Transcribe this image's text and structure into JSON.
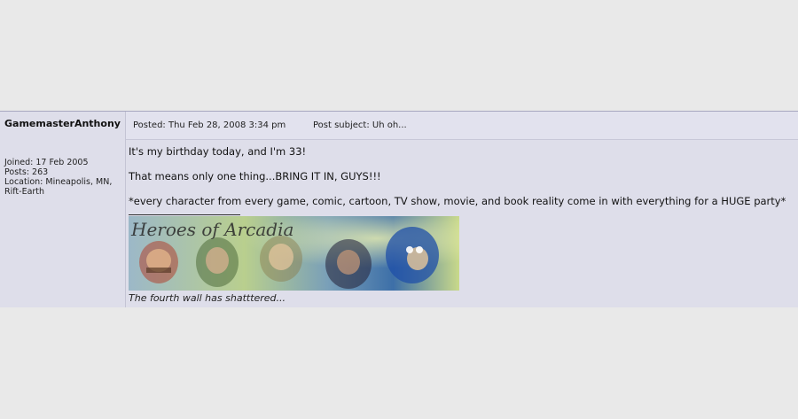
{
  "author": {
    "name": "GamemasterAnthony",
    "joined": "Joined: 17 Feb 2005",
    "posts": "Posts: 263",
    "location": "Location: Mineapolis, MN, Rift-Earth"
  },
  "post": {
    "posted": "Posted: Thu Feb 28, 2008 3:34 pm",
    "subject": "Post subject: Uh oh...",
    "lines": [
      "It's my birthday today, and I'm 33!",
      "That means only one thing...BRING IT IN, GUYS!!!",
      "*every character from every game, comic, cartoon, TV show, movie, and book reality come in with everything for a HUGE party*"
    ]
  },
  "signature": {
    "banner_title": "Heroes of Arcadia",
    "caption": "The fourth wall has shatttered..."
  },
  "colors": {
    "page_bg": "#e9e9e9",
    "post_bg": "#dedeea",
    "border": "#a7a7bf"
  }
}
